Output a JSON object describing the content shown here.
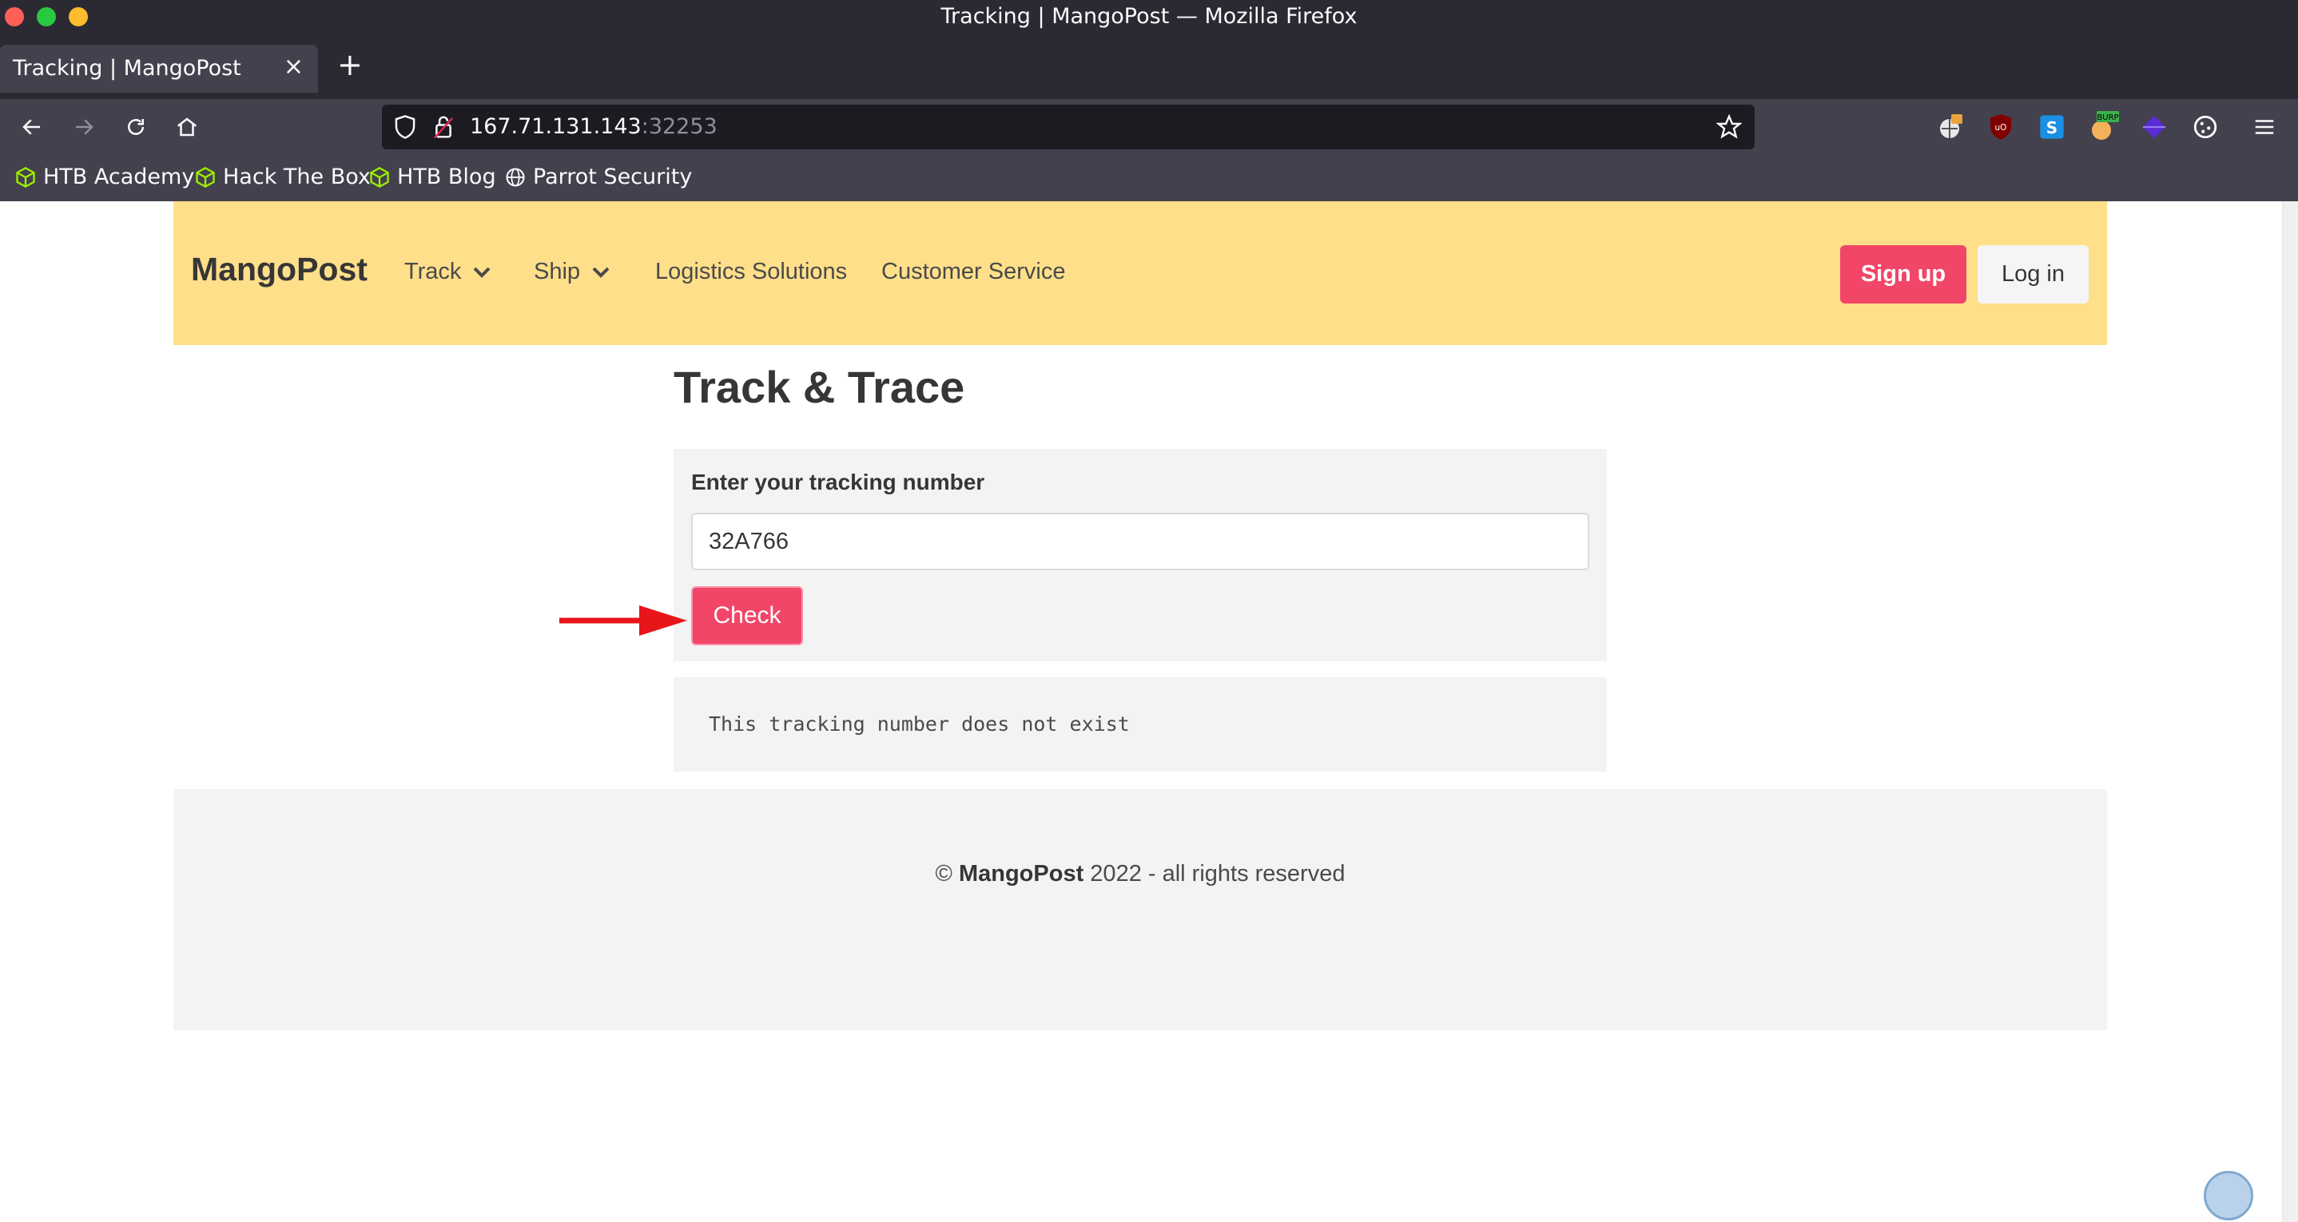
{
  "window": {
    "title": "Tracking | MangoPost — Mozilla Firefox",
    "traffic_light_colors": [
      "#ff5f57",
      "#28c840",
      "#febc2e"
    ]
  },
  "tab": {
    "title": "Tracking | MangoPost",
    "close_glyph": "×",
    "new_tab_glyph": "+"
  },
  "urlbar": {
    "host": "167.71.131.143",
    "port": ":32253"
  },
  "extensions": [
    "burp-proxy-icon",
    "ublock-icon",
    "s-extension-icon",
    "burp-badge-icon",
    "purple-cube-icon",
    "cookie-icon",
    "hamburger-menu-icon"
  ],
  "bookmarks": [
    {
      "label": "HTB Academy",
      "icon": "htb-cube-icon"
    },
    {
      "label": "Hack The Box",
      "icon": "htb-cube-icon"
    },
    {
      "label": "HTB Blog",
      "icon": "htb-cube-icon"
    },
    {
      "label": "Parrot Security",
      "icon": "globe-icon"
    }
  ],
  "site": {
    "brand": "MangoPost",
    "nav": {
      "track": "Track",
      "ship": "Ship",
      "logistics": "Logistics Solutions",
      "customer_service": "Customer Service"
    },
    "signup": "Sign up",
    "login": "Log in"
  },
  "main": {
    "title": "Track & Trace",
    "form_label": "Enter your tracking number",
    "tracking_value": "32A766",
    "check_label": "Check",
    "result": "This tracking number does not exist"
  },
  "footer": {
    "prefix": "© ",
    "brand": "MangoPost",
    "suffix": " 2022 - all rights reserved"
  },
  "colors": {
    "nav_bg": "#ffdf8a",
    "primary": "#f14668",
    "annotation_arrow": "#e8151b"
  }
}
